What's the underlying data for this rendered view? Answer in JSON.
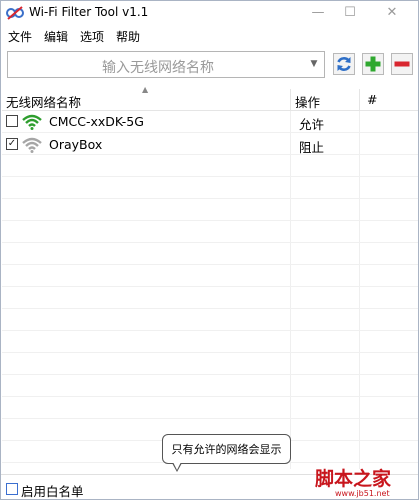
{
  "window": {
    "title": "Wi-Fi Filter Tool v1.1",
    "minimize_glyph": "—",
    "maximize_glyph": "☐",
    "close_glyph": "✕"
  },
  "menu": {
    "items": [
      "文件",
      "编辑",
      "选项",
      "帮助"
    ]
  },
  "toolbar": {
    "ssid_placeholder": "输入无线网络名称",
    "refresh_icon": "refresh-icon",
    "add_icon": "plus-icon",
    "remove_icon": "minus-icon"
  },
  "list": {
    "columns": [
      "无线网络名称",
      "操作",
      "#"
    ],
    "rows": [
      {
        "checked": false,
        "ssid": "CMCC-xxDK-5G",
        "action": "允许",
        "wifi_color": "#2e9e2e",
        "checkbox_glyph": ""
      },
      {
        "checked": true,
        "ssid": "OrayBox",
        "action": "阻止",
        "wifi_color": "#a6a6a6",
        "checkbox_glyph": "✓"
      }
    ]
  },
  "tooltip": {
    "text": "只有允许的网络会显示"
  },
  "statusbar": {
    "whitelist_label": "启用白名单",
    "whitelist_checked": false
  },
  "watermark": {
    "text": "脚本之家",
    "url": "www.jb51.net"
  },
  "colors": {
    "accent_green": "#2fa82f",
    "accent_red": "#d9262f",
    "refresh_blue": "#2f6fc7"
  }
}
